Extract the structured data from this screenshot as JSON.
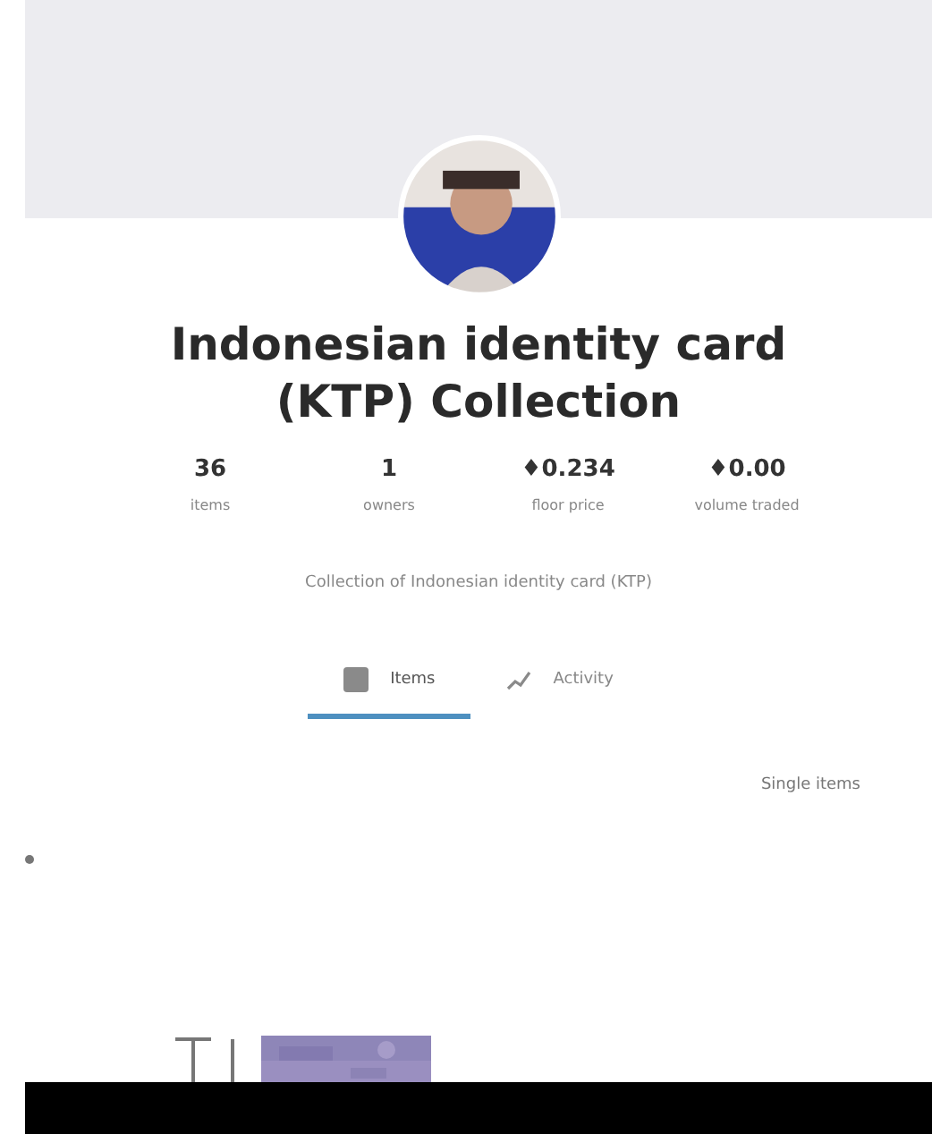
{
  "collection": {
    "title": "Indonesian identity card (KTP) Collection",
    "description": "Collection of Indonesian identity card (KTP)"
  },
  "stats": [
    {
      "value": "36",
      "label": "items"
    },
    {
      "value": "1",
      "label": "owners"
    },
    {
      "value": "♦0.234",
      "label": "floor price"
    },
    {
      "value": "♦0.00",
      "label": "volume traded"
    }
  ],
  "tabs": [
    {
      "label": "Items",
      "selected": true,
      "kind": "grid"
    },
    {
      "label": "Activity",
      "selected": false,
      "kind": "chart"
    }
  ],
  "filter": {
    "label": "Single items"
  }
}
